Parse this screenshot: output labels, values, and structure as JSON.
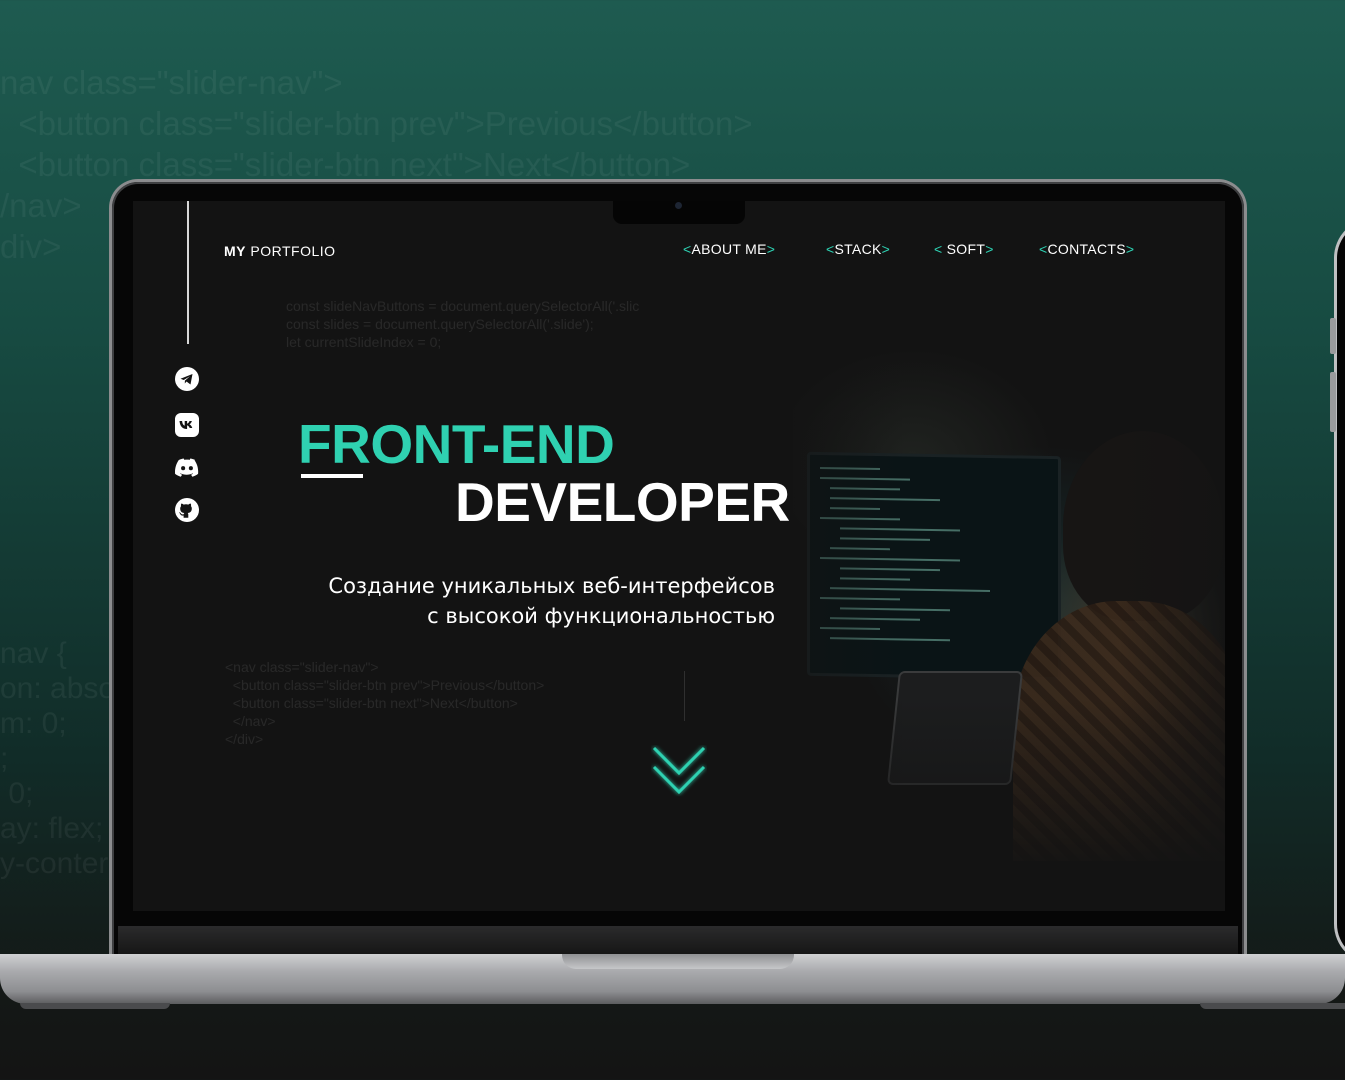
{
  "background": {
    "code_top": [
      "nav class=\"slider-nav\">",
      "  <button class=\"slider-btn prev\">Previous</button>",
      "  <button class=\"slider-btn next\">Next</button>",
      "/nav>",
      "div>"
    ],
    "code_left": [
      "nav {",
      "on: abso",
      "m: 0;",
      ";",
      " 0;",
      "ay: flex;",
      "y-conter"
    ]
  },
  "site": {
    "logo_bold": "MY",
    "logo_rest": " PORTFOLIO",
    "nav": [
      {
        "open": "<",
        "label": "ABOUT ME",
        "close": ">"
      },
      {
        "open": "<",
        "label": "STACK",
        "close": ">"
      },
      {
        "open": "< ",
        "label": "SOFT",
        "close": ">"
      },
      {
        "open": "<",
        "label": "CONTACTS",
        "close": ">"
      }
    ],
    "code_top": [
      "const slideNavButtons = document.querySelectorAll('.slic",
      "const slides = document.querySelectorAll('.slide');",
      "let currentSlideIndex = 0;"
    ],
    "code_bottom": [
      "<nav class=\"slider-nav\">",
      "  <button class=\"slider-btn prev\">Previous</button>",
      "  <button class=\"slider-btn next\">Next</button>",
      "  </nav>",
      "</div>"
    ],
    "title_line1": "FRONT-END",
    "title_line2": "DEVELOPER",
    "subtitle_line1": "Создание уникальных веб-интерфейсов",
    "subtitle_line2": "с высокой функциональностью",
    "social_icons": [
      "telegram-icon",
      "vk-icon",
      "discord-icon",
      "github-icon"
    ],
    "accent_color": "#2fd1b1"
  }
}
